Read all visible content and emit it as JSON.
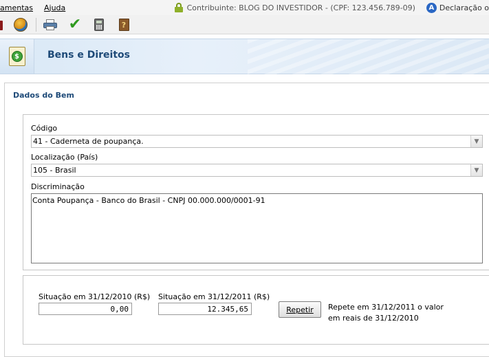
{
  "menu": {
    "items": [
      {
        "label": "amentas"
      },
      {
        "label": "Ajuda"
      }
    ]
  },
  "status": {
    "contribuinte": "Contribuinte: BLOG DO INVESTIDOR - (CPF: 123.456.789-09)",
    "declaracao_icon_letter": "A",
    "declaracao": "Declaração o"
  },
  "toolbar": {
    "icons": [
      "red-icon",
      "globe-icon",
      "print-icon",
      "check-icon",
      "calculator-icon",
      "help-book-icon"
    ],
    "help_glyph": "?"
  },
  "banner": {
    "title": "Bens e Direitos",
    "icon_glyph": "$"
  },
  "form": {
    "section_title": "Dados do Bem",
    "codigo_label": "Código",
    "codigo_value": "41 - Caderneta de poupança.",
    "localizacao_label": "Localização (País)",
    "localizacao_value": "105 - Brasil",
    "discriminacao_label": "Discriminação",
    "discriminacao_value": "Conta Poupança - Banco do Brasil - CNPJ 00.000.000/0001-91",
    "sit2010_label": "Situação em 31/12/2010 (R$)",
    "sit2010_value": "0,00",
    "sit2011_label": "Situação em 31/12/2011 (R$)",
    "sit2011_value": "12.345,65",
    "repetir_label": "Repetir",
    "repete_note_line1": "Repete em 31/12/2011 o valor",
    "repete_note_line2": "em reais de 31/12/2010"
  },
  "colors": {
    "title_blue": "#1e4a78",
    "banner_bg": "#dbe8f5",
    "check_green": "#2f9a1f"
  }
}
